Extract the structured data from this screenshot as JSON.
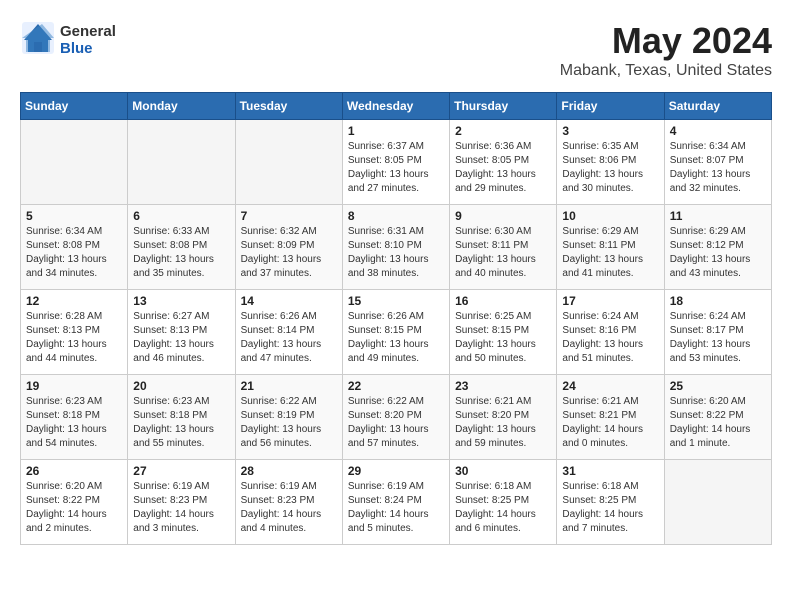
{
  "logo": {
    "general": "General",
    "blue": "Blue"
  },
  "header": {
    "month": "May 2024",
    "location": "Mabank, Texas, United States"
  },
  "weekdays": [
    "Sunday",
    "Monday",
    "Tuesday",
    "Wednesday",
    "Thursday",
    "Friday",
    "Saturday"
  ],
  "weeks": [
    [
      {
        "day": "",
        "empty": true
      },
      {
        "day": "",
        "empty": true
      },
      {
        "day": "",
        "empty": true
      },
      {
        "day": "1",
        "sunrise": "Sunrise: 6:37 AM",
        "sunset": "Sunset: 8:05 PM",
        "daylight": "Daylight: 13 hours and 27 minutes."
      },
      {
        "day": "2",
        "sunrise": "Sunrise: 6:36 AM",
        "sunset": "Sunset: 8:05 PM",
        "daylight": "Daylight: 13 hours and 29 minutes."
      },
      {
        "day": "3",
        "sunrise": "Sunrise: 6:35 AM",
        "sunset": "Sunset: 8:06 PM",
        "daylight": "Daylight: 13 hours and 30 minutes."
      },
      {
        "day": "4",
        "sunrise": "Sunrise: 6:34 AM",
        "sunset": "Sunset: 8:07 PM",
        "daylight": "Daylight: 13 hours and 32 minutes."
      }
    ],
    [
      {
        "day": "5",
        "sunrise": "Sunrise: 6:34 AM",
        "sunset": "Sunset: 8:08 PM",
        "daylight": "Daylight: 13 hours and 34 minutes."
      },
      {
        "day": "6",
        "sunrise": "Sunrise: 6:33 AM",
        "sunset": "Sunset: 8:08 PM",
        "daylight": "Daylight: 13 hours and 35 minutes."
      },
      {
        "day": "7",
        "sunrise": "Sunrise: 6:32 AM",
        "sunset": "Sunset: 8:09 PM",
        "daylight": "Daylight: 13 hours and 37 minutes."
      },
      {
        "day": "8",
        "sunrise": "Sunrise: 6:31 AM",
        "sunset": "Sunset: 8:10 PM",
        "daylight": "Daylight: 13 hours and 38 minutes."
      },
      {
        "day": "9",
        "sunrise": "Sunrise: 6:30 AM",
        "sunset": "Sunset: 8:11 PM",
        "daylight": "Daylight: 13 hours and 40 minutes."
      },
      {
        "day": "10",
        "sunrise": "Sunrise: 6:29 AM",
        "sunset": "Sunset: 8:11 PM",
        "daylight": "Daylight: 13 hours and 41 minutes."
      },
      {
        "day": "11",
        "sunrise": "Sunrise: 6:29 AM",
        "sunset": "Sunset: 8:12 PM",
        "daylight": "Daylight: 13 hours and 43 minutes."
      }
    ],
    [
      {
        "day": "12",
        "sunrise": "Sunrise: 6:28 AM",
        "sunset": "Sunset: 8:13 PM",
        "daylight": "Daylight: 13 hours and 44 minutes."
      },
      {
        "day": "13",
        "sunrise": "Sunrise: 6:27 AM",
        "sunset": "Sunset: 8:13 PM",
        "daylight": "Daylight: 13 hours and 46 minutes."
      },
      {
        "day": "14",
        "sunrise": "Sunrise: 6:26 AM",
        "sunset": "Sunset: 8:14 PM",
        "daylight": "Daylight: 13 hours and 47 minutes."
      },
      {
        "day": "15",
        "sunrise": "Sunrise: 6:26 AM",
        "sunset": "Sunset: 8:15 PM",
        "daylight": "Daylight: 13 hours and 49 minutes."
      },
      {
        "day": "16",
        "sunrise": "Sunrise: 6:25 AM",
        "sunset": "Sunset: 8:15 PM",
        "daylight": "Daylight: 13 hours and 50 minutes."
      },
      {
        "day": "17",
        "sunrise": "Sunrise: 6:24 AM",
        "sunset": "Sunset: 8:16 PM",
        "daylight": "Daylight: 13 hours and 51 minutes."
      },
      {
        "day": "18",
        "sunrise": "Sunrise: 6:24 AM",
        "sunset": "Sunset: 8:17 PM",
        "daylight": "Daylight: 13 hours and 53 minutes."
      }
    ],
    [
      {
        "day": "19",
        "sunrise": "Sunrise: 6:23 AM",
        "sunset": "Sunset: 8:18 PM",
        "daylight": "Daylight: 13 hours and 54 minutes."
      },
      {
        "day": "20",
        "sunrise": "Sunrise: 6:23 AM",
        "sunset": "Sunset: 8:18 PM",
        "daylight": "Daylight: 13 hours and 55 minutes."
      },
      {
        "day": "21",
        "sunrise": "Sunrise: 6:22 AM",
        "sunset": "Sunset: 8:19 PM",
        "daylight": "Daylight: 13 hours and 56 minutes."
      },
      {
        "day": "22",
        "sunrise": "Sunrise: 6:22 AM",
        "sunset": "Sunset: 8:20 PM",
        "daylight": "Daylight: 13 hours and 57 minutes."
      },
      {
        "day": "23",
        "sunrise": "Sunrise: 6:21 AM",
        "sunset": "Sunset: 8:20 PM",
        "daylight": "Daylight: 13 hours and 59 minutes."
      },
      {
        "day": "24",
        "sunrise": "Sunrise: 6:21 AM",
        "sunset": "Sunset: 8:21 PM",
        "daylight": "Daylight: 14 hours and 0 minutes."
      },
      {
        "day": "25",
        "sunrise": "Sunrise: 6:20 AM",
        "sunset": "Sunset: 8:22 PM",
        "daylight": "Daylight: 14 hours and 1 minute."
      }
    ],
    [
      {
        "day": "26",
        "sunrise": "Sunrise: 6:20 AM",
        "sunset": "Sunset: 8:22 PM",
        "daylight": "Daylight: 14 hours and 2 minutes."
      },
      {
        "day": "27",
        "sunrise": "Sunrise: 6:19 AM",
        "sunset": "Sunset: 8:23 PM",
        "daylight": "Daylight: 14 hours and 3 minutes."
      },
      {
        "day": "28",
        "sunrise": "Sunrise: 6:19 AM",
        "sunset": "Sunset: 8:23 PM",
        "daylight": "Daylight: 14 hours and 4 minutes."
      },
      {
        "day": "29",
        "sunrise": "Sunrise: 6:19 AM",
        "sunset": "Sunset: 8:24 PM",
        "daylight": "Daylight: 14 hours and 5 minutes."
      },
      {
        "day": "30",
        "sunrise": "Sunrise: 6:18 AM",
        "sunset": "Sunset: 8:25 PM",
        "daylight": "Daylight: 14 hours and 6 minutes."
      },
      {
        "day": "31",
        "sunrise": "Sunrise: 6:18 AM",
        "sunset": "Sunset: 8:25 PM",
        "daylight": "Daylight: 14 hours and 7 minutes."
      },
      {
        "day": "",
        "empty": true
      }
    ]
  ]
}
